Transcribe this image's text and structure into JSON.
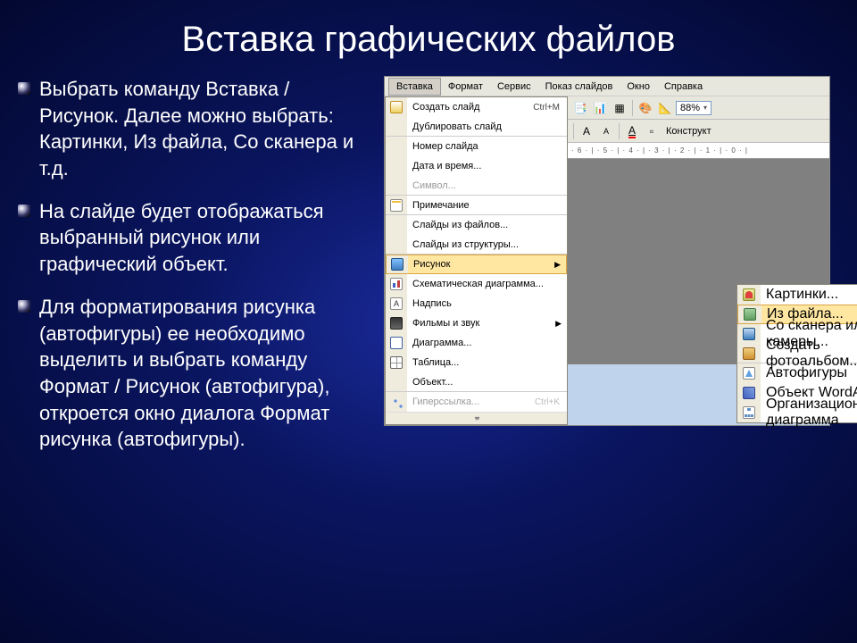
{
  "title": "Вставка графических файлов",
  "bullets": [
    "Выбрать команду Вставка / Рисунок. Далее можно выбрать: Картинки, Из файла, Со сканера и т.д.",
    "На слайде будет отображаться выбранный рисунок или графический объект.",
    " Для форматирования рисунка (автофигуры) ее необходимо выделить и выбрать команду Формат / Рисунок (автофигура), откроется окно диалога Формат рисунка (автофигуры)."
  ],
  "menubar": [
    "Вставка",
    "Формат",
    "Сервис",
    "Показ слайдов",
    "Окно",
    "Справка"
  ],
  "zoom": "88%",
  "konstruktor": "Конструкт",
  "ruler": "· 6 · | · 5 · | · 4 · | · 3 · | · 2 · | · 1 · | · 0 · |",
  "menu_items": [
    {
      "icon": "ic-new",
      "label": "Создать слайд",
      "shortcut": "Ctrl+M",
      "arrow": false,
      "dim": false,
      "sep": false
    },
    {
      "icon": "",
      "label": "Дублировать слайд",
      "shortcut": "",
      "arrow": false,
      "dim": false,
      "sep": true
    },
    {
      "icon": "",
      "label": "Номер слайда",
      "shortcut": "",
      "arrow": false,
      "dim": false,
      "sep": false
    },
    {
      "icon": "",
      "label": "Дата и время...",
      "shortcut": "",
      "arrow": false,
      "dim": false,
      "sep": false
    },
    {
      "icon": "",
      "label": "Символ...",
      "shortcut": "",
      "arrow": false,
      "dim": true,
      "sep": true
    },
    {
      "icon": "ic-note",
      "label": "Примечание",
      "shortcut": "",
      "arrow": false,
      "dim": false,
      "sep": true
    },
    {
      "icon": "",
      "label": "Слайды из файлов...",
      "shortcut": "",
      "arrow": false,
      "dim": false,
      "sep": false
    },
    {
      "icon": "",
      "label": "Слайды из структуры...",
      "shortcut": "",
      "arrow": false,
      "dim": false,
      "sep": true
    },
    {
      "icon": "ic-pic",
      "label": "Рисунок",
      "shortcut": "",
      "arrow": true,
      "dim": false,
      "sep": false,
      "hl": true
    },
    {
      "icon": "ic-chart",
      "label": "Схематическая диаграмма...",
      "shortcut": "",
      "arrow": false,
      "dim": false,
      "sep": false
    },
    {
      "icon": "ic-text",
      "label": "Надпись",
      "shortcut": "",
      "arrow": false,
      "dim": false,
      "sep": false
    },
    {
      "icon": "ic-movie",
      "label": "Фильмы и звук",
      "shortcut": "",
      "arrow": true,
      "dim": false,
      "sep": false
    },
    {
      "icon": "ic-diag",
      "label": "Диаграмма...",
      "shortcut": "",
      "arrow": false,
      "dim": false,
      "sep": false
    },
    {
      "icon": "ic-table",
      "label": "Таблица...",
      "shortcut": "",
      "arrow": false,
      "dim": false,
      "sep": false
    },
    {
      "icon": "",
      "label": "Объект...",
      "shortcut": "",
      "arrow": false,
      "dim": false,
      "sep": true
    },
    {
      "icon": "ic-link",
      "label": "Гиперссылка...",
      "shortcut": "Ctrl+K",
      "arrow": false,
      "dim": true,
      "sep": false
    }
  ],
  "submenu_items": [
    {
      "icon": "ic-clipart",
      "label": "Картинки...",
      "hl": false,
      "sep": false
    },
    {
      "icon": "ic-file",
      "label": "Из файла...",
      "hl": true,
      "sep": false
    },
    {
      "icon": "ic-scan",
      "label": "Со сканера или камеры...",
      "hl": false,
      "sep": false
    },
    {
      "icon": "ic-photo",
      "label": "Создать фотоальбом...",
      "hl": false,
      "sep": true
    },
    {
      "icon": "ic-shapes",
      "label": "Автофигуры",
      "hl": false,
      "sep": false
    },
    {
      "icon": "ic-wordart",
      "label": "Объект WordArt...",
      "hl": false,
      "sep": false
    },
    {
      "icon": "ic-org",
      "label": "Организационная диаграмма",
      "hl": false,
      "sep": false
    }
  ]
}
